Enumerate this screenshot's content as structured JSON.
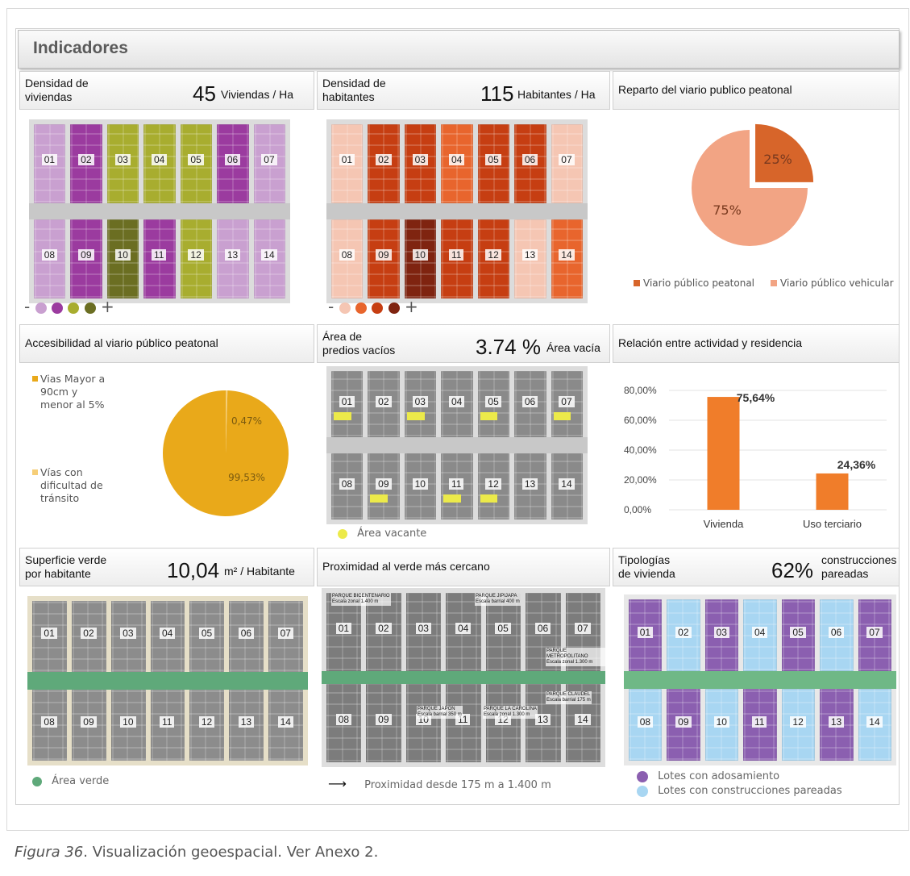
{
  "title": "Indicadores",
  "block_numbers": [
    "01",
    "02",
    "03",
    "04",
    "05",
    "06",
    "07",
    "08",
    "09",
    "10",
    "11",
    "12",
    "13",
    "14"
  ],
  "density_housing": {
    "label_line1": "Densidad de",
    "label_line2": "viviendas",
    "value": "45",
    "unit": "Viviendas / Ha",
    "minus": "-",
    "plus": "+",
    "scale_colors": [
      "#c9a0d0",
      "#9b3b9f",
      "#a8ad2f",
      "#6b6e22"
    ]
  },
  "density_inhabitants": {
    "label_line1": "Densidad de",
    "label_line2": "habitantes",
    "value": "115",
    "unit": "Habitantes / Ha",
    "minus": "-",
    "plus": "+",
    "scale_colors": [
      "#f5c6b3",
      "#e8652d",
      "#c63e12",
      "#7f2410"
    ]
  },
  "pedestrian_share": {
    "title": "Reparto del viario publico peatonal",
    "chart_data": {
      "type": "pie",
      "labels": [
        "Viario público peatonal",
        "Viario público vehicular"
      ],
      "values": [
        25,
        75
      ],
      "value_labels": [
        "25%",
        "75%"
      ],
      "colors": [
        "#d7652a",
        "#f2a484"
      ]
    }
  },
  "accessibility": {
    "title": "Accesibilidad al viario público peatonal",
    "legend_1": [
      "Vias Mayor a",
      "90cm y",
      "menor al 5%"
    ],
    "legend_2": [
      "Vías con",
      "dificultad de",
      "tránsito"
    ],
    "chart_data": {
      "type": "pie",
      "labels": [
        "Vias Mayor a 90cm y menor al 5%",
        "Vías con dificultad de tránsito"
      ],
      "values": [
        0.47,
        99.53
      ],
      "value_labels": [
        "0,47%",
        "99,53%"
      ],
      "colors": [
        "#f6ce78",
        "#e9a91a"
      ]
    }
  },
  "vacant_area": {
    "label_line1": "Área de",
    "label_line2": "predios vacíos",
    "value": "3.74 %",
    "unit": "Área vacía",
    "legend": "Área vacante",
    "legend_color": "#ecea4a"
  },
  "activity_residence": {
    "title": "Relación entre actividad y residencia",
    "chart_data": {
      "type": "bar",
      "categories": [
        "Vivienda",
        "Uso terciario"
      ],
      "values": [
        75.64,
        24.36
      ],
      "data_labels": [
        "75,64%",
        "24,36%"
      ],
      "yticks": [
        "80,00%",
        "60,00%",
        "40,00%",
        "20,00%",
        "0,00%"
      ],
      "ylim": [
        0,
        80
      ],
      "color": "#f07d2a"
    }
  },
  "green_surface": {
    "label_line1": "Superficie verde",
    "label_line2": "por habitante",
    "value": "10,04",
    "unit": "m² / Habitante",
    "legend": "Área verde",
    "legend_color": "#5fa97a"
  },
  "green_proximity": {
    "title": "Proximidad al verde más cercano",
    "parks": [
      {
        "name": "PARQUE BICENTENARIO",
        "scale": "Escala zonal 1.400 m"
      },
      {
        "name": "PARQUE JIPIJAPA",
        "scale": "Escala barrial 400 m"
      },
      {
        "name": "PARQUE METROPOLITANO",
        "scale": "Escala zonal 1.300 m"
      },
      {
        "name": "PARQUE CLAUDEL",
        "scale": "Escala barrial 175 m"
      },
      {
        "name": "PARQUE JAPON",
        "scale": "Escala barrial 350 m"
      },
      {
        "name": "PARQUE LA CAROLINA",
        "scale": "Escala zonal 1.300 m"
      }
    ],
    "legend": "Proximidad desde 175 m a 1.400 m"
  },
  "housing_types": {
    "label_line1": "Tipologías",
    "label_line2": "de vivienda",
    "value": "62%",
    "unit_line1": "construcciones",
    "unit_line2": "pareadas",
    "legend_1": "Lotes con adosamiento",
    "legend_2": "Lotes con construcciones pareadas",
    "legend_color_1": "#8b5fb0",
    "legend_color_2": "#a8d6f2"
  },
  "caption_prefix": "Figura 36",
  "caption_text": ". Visualización geoespacial. Ver Anexo 2."
}
